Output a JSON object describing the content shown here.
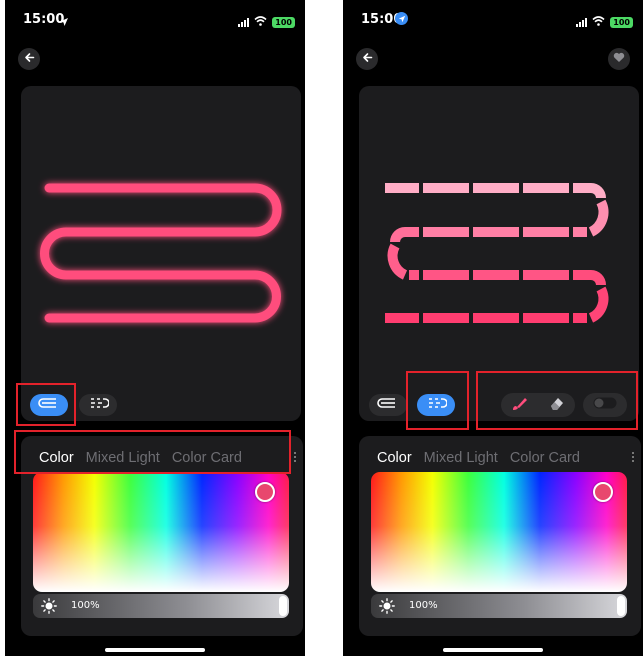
{
  "colors": {
    "accent_blue": "#3a8ef6",
    "strip_pink": "#ff4d7d",
    "highlight_red": "#e3222b",
    "background": "#000000",
    "card": "#1c1c1e"
  },
  "left_phone": {
    "status": {
      "time": "15:00",
      "battery": "100"
    },
    "back_icon": "arrow-left-icon",
    "active_mode": "continuous-strip",
    "tabs": [
      {
        "label": "Color",
        "active": true
      },
      {
        "label": "Mixed Light",
        "active": false
      },
      {
        "label": "Color Card",
        "active": false
      }
    ],
    "brightness_label": "100%",
    "brightness": 1.0
  },
  "right_phone": {
    "status": {
      "time": "15:00",
      "battery": "100"
    },
    "back_icon": "arrow-left-icon",
    "favorite_icon": "heart-icon",
    "active_mode": "segmented-strip",
    "tools": [
      "brush-icon",
      "eraser-icon",
      "toggle-icon"
    ],
    "tabs": [
      {
        "label": "Color",
        "active": true
      },
      {
        "label": "Mixed Light",
        "active": false
      },
      {
        "label": "Color Card",
        "active": false
      }
    ],
    "brightness_label": "100%",
    "brightness": 1.0
  }
}
